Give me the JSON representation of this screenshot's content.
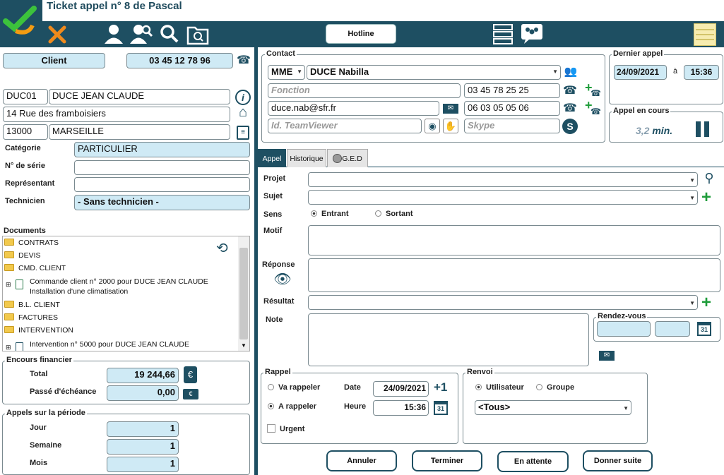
{
  "window": {
    "title": "Ticket appel n° 8 de Pascal"
  },
  "toolbar": {
    "hotline": "Hotline"
  },
  "client": {
    "title": "Client",
    "phone": "03 45 12 78 96",
    "code": "DUC01",
    "name": "DUCE JEAN CLAUDE",
    "address": "14 Rue des framboisiers",
    "zip": "13000",
    "city": "MARSEILLE",
    "categorie_label": "Catégorie",
    "categorie": "PARTICULIER",
    "serie_label": "N° de série",
    "serie": "",
    "representant_label": "Représentant",
    "representant": "",
    "technicien_label": "Technicien",
    "technicien": "- Sans technicien -"
  },
  "documents": {
    "title": "Documents",
    "items": [
      {
        "type": "folder",
        "label": "CONTRATS"
      },
      {
        "type": "folder",
        "label": "DEVIS"
      },
      {
        "type": "folder",
        "label": "CMD. CLIENT"
      },
      {
        "type": "doc",
        "label": "Commande client n° 2000 pour DUCE JEAN CLAUDE",
        "sub": "Installation d'une climatisation"
      },
      {
        "type": "folder",
        "label": "B.L. CLIENT"
      },
      {
        "type": "folder",
        "label": "FACTURES"
      },
      {
        "type": "folder",
        "label": "INTERVENTION"
      },
      {
        "type": "doc",
        "label": "Intervention n° 5000 pour DUCE JEAN CLAUDE",
        "sub": ""
      }
    ]
  },
  "encours": {
    "title": "Encours financier",
    "total_label": "Total",
    "total": "19 244,66",
    "echeance_label": "Passé d'échéance",
    "echeance": "0,00"
  },
  "appels": {
    "title": "Appels sur la période",
    "jour_label": "Jour",
    "jour": "1",
    "semaine_label": "Semaine",
    "semaine": "1",
    "mois_label": "Mois",
    "mois": "1"
  },
  "contact": {
    "title": "Contact",
    "civilite": "MME",
    "name": "DUCE Nabilla",
    "fonction_ph": "Fonction",
    "phone1": "03 45 78 25 25",
    "email": "duce.nab@sfr.fr",
    "phone2": "06 03 05 05 06",
    "teamviewer_ph": "Id. TeamViewer",
    "skype_ph": "Skype"
  },
  "dernier": {
    "title": "Dernier appel",
    "date": "24/09/2021",
    "a": "à",
    "time": "15:36"
  },
  "encours_appel": {
    "title": "Appel en cours",
    "duration": "3,2",
    "unit": "min."
  },
  "tabs": {
    "appel": "Appel",
    "historique": "Historique",
    "ged": "G.E.D"
  },
  "form": {
    "projet": "Projet",
    "sujet": "Sujet",
    "sens": "Sens",
    "entrant": "Entrant",
    "sortant": "Sortant",
    "motif": "Motif",
    "reponse": "Réponse",
    "resultat": "Résultat",
    "note": "Note",
    "rdv": "Rendez-vous"
  },
  "rappel": {
    "title": "Rappel",
    "va": "Va rappeler",
    "a": "A rappeler",
    "urgent": "Urgent",
    "date_label": "Date",
    "date": "24/09/2021",
    "heure_label": "Heure",
    "heure": "15:36"
  },
  "renvoi": {
    "title": "Renvoi",
    "utilisateur": "Utilisateur",
    "groupe": "Groupe",
    "select": "<Tous>"
  },
  "buttons": {
    "annuler": "Annuler",
    "terminer": "Terminer",
    "attente": "En attente",
    "suite": "Donner suite"
  }
}
